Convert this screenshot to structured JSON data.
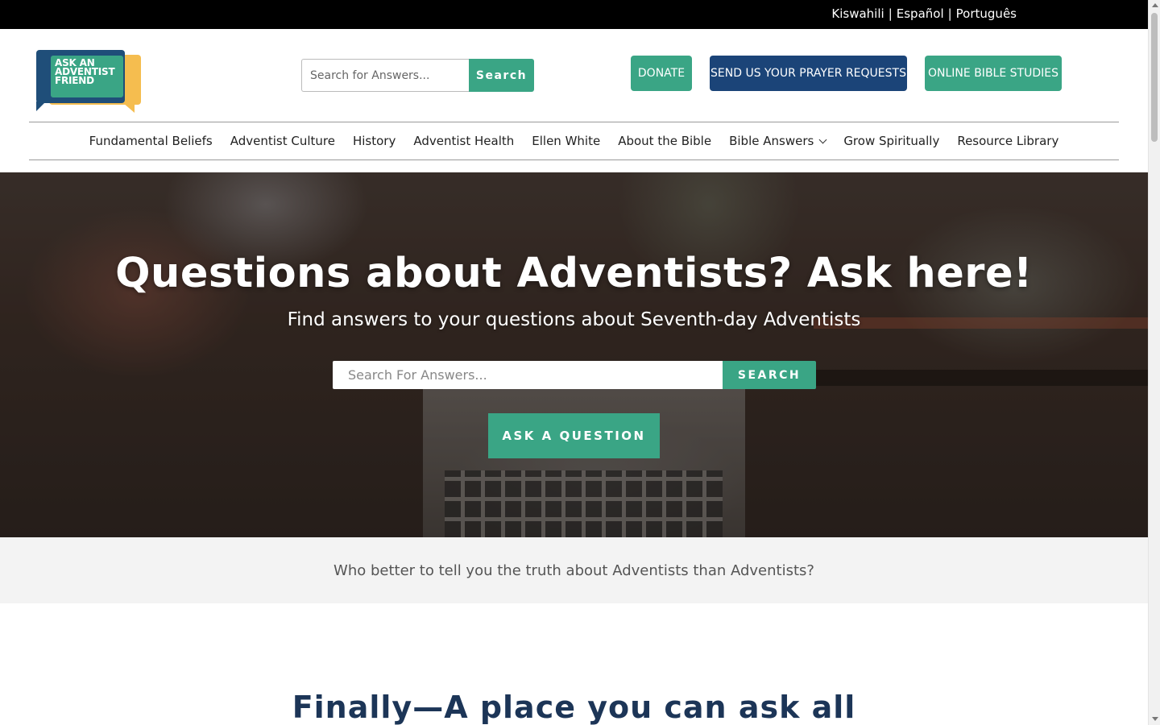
{
  "languages": {
    "items": [
      "Kiswahili",
      "Español",
      "Português"
    ],
    "separator": "|"
  },
  "logo": {
    "line1": "ASK AN",
    "line2": "ADVENTIST",
    "line3": "FRIEND"
  },
  "header_search": {
    "placeholder": "Search for Answers...",
    "button_label": "Search"
  },
  "header_buttons": {
    "donate": "DONATE",
    "prayer": "SEND US YOUR PRAYER REQUESTS",
    "bible_studies": "ONLINE BIBLE STUDIES"
  },
  "nav": {
    "items": [
      {
        "label": "Fundamental Beliefs"
      },
      {
        "label": "Adventist Culture"
      },
      {
        "label": "History"
      },
      {
        "label": "Adventist Health"
      },
      {
        "label": "Ellen White"
      },
      {
        "label": "About the Bible"
      },
      {
        "label": "Bible Answers",
        "icon": "chevron-down-icon"
      },
      {
        "label": "Grow Spiritually"
      },
      {
        "label": "Resource Library"
      }
    ]
  },
  "hero": {
    "title": "Questions about Adventists? Ask here!",
    "subtitle": "Find answers to your questions about Seventh-day Adventists",
    "search_placeholder": "Search For Answers...",
    "search_button": "SEARCH",
    "ask_button": "ASK A QUESTION"
  },
  "tagline": "Who better to tell you the truth about Adventists than Adventists?",
  "section": {
    "title": "Finally—A place you can ask all"
  },
  "colors": {
    "accent_green": "#3aa585",
    "brand_navy": "#1b4478",
    "logo_yellow": "#f5bd4f",
    "heading_navy": "#1c3557"
  }
}
